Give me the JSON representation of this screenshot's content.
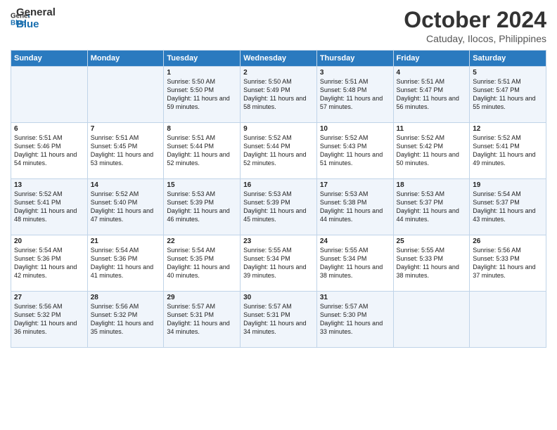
{
  "header": {
    "logo_line1": "General",
    "logo_line2": "Blue",
    "month": "October 2024",
    "location": "Catuday, Ilocos, Philippines"
  },
  "days_of_week": [
    "Sunday",
    "Monday",
    "Tuesday",
    "Wednesday",
    "Thursday",
    "Friday",
    "Saturday"
  ],
  "weeks": [
    [
      {
        "day": "",
        "content": ""
      },
      {
        "day": "",
        "content": ""
      },
      {
        "day": "1",
        "content": "Sunrise: 5:50 AM\nSunset: 5:50 PM\nDaylight: 11 hours and 59 minutes."
      },
      {
        "day": "2",
        "content": "Sunrise: 5:50 AM\nSunset: 5:49 PM\nDaylight: 11 hours and 58 minutes."
      },
      {
        "day": "3",
        "content": "Sunrise: 5:51 AM\nSunset: 5:48 PM\nDaylight: 11 hours and 57 minutes."
      },
      {
        "day": "4",
        "content": "Sunrise: 5:51 AM\nSunset: 5:47 PM\nDaylight: 11 hours and 56 minutes."
      },
      {
        "day": "5",
        "content": "Sunrise: 5:51 AM\nSunset: 5:47 PM\nDaylight: 11 hours and 55 minutes."
      }
    ],
    [
      {
        "day": "6",
        "content": "Sunrise: 5:51 AM\nSunset: 5:46 PM\nDaylight: 11 hours and 54 minutes."
      },
      {
        "day": "7",
        "content": "Sunrise: 5:51 AM\nSunset: 5:45 PM\nDaylight: 11 hours and 53 minutes."
      },
      {
        "day": "8",
        "content": "Sunrise: 5:51 AM\nSunset: 5:44 PM\nDaylight: 11 hours and 52 minutes."
      },
      {
        "day": "9",
        "content": "Sunrise: 5:52 AM\nSunset: 5:44 PM\nDaylight: 11 hours and 52 minutes."
      },
      {
        "day": "10",
        "content": "Sunrise: 5:52 AM\nSunset: 5:43 PM\nDaylight: 11 hours and 51 minutes."
      },
      {
        "day": "11",
        "content": "Sunrise: 5:52 AM\nSunset: 5:42 PM\nDaylight: 11 hours and 50 minutes."
      },
      {
        "day": "12",
        "content": "Sunrise: 5:52 AM\nSunset: 5:41 PM\nDaylight: 11 hours and 49 minutes."
      }
    ],
    [
      {
        "day": "13",
        "content": "Sunrise: 5:52 AM\nSunset: 5:41 PM\nDaylight: 11 hours and 48 minutes."
      },
      {
        "day": "14",
        "content": "Sunrise: 5:52 AM\nSunset: 5:40 PM\nDaylight: 11 hours and 47 minutes."
      },
      {
        "day": "15",
        "content": "Sunrise: 5:53 AM\nSunset: 5:39 PM\nDaylight: 11 hours and 46 minutes."
      },
      {
        "day": "16",
        "content": "Sunrise: 5:53 AM\nSunset: 5:39 PM\nDaylight: 11 hours and 45 minutes."
      },
      {
        "day": "17",
        "content": "Sunrise: 5:53 AM\nSunset: 5:38 PM\nDaylight: 11 hours and 44 minutes."
      },
      {
        "day": "18",
        "content": "Sunrise: 5:53 AM\nSunset: 5:37 PM\nDaylight: 11 hours and 44 minutes."
      },
      {
        "day": "19",
        "content": "Sunrise: 5:54 AM\nSunset: 5:37 PM\nDaylight: 11 hours and 43 minutes."
      }
    ],
    [
      {
        "day": "20",
        "content": "Sunrise: 5:54 AM\nSunset: 5:36 PM\nDaylight: 11 hours and 42 minutes."
      },
      {
        "day": "21",
        "content": "Sunrise: 5:54 AM\nSunset: 5:36 PM\nDaylight: 11 hours and 41 minutes."
      },
      {
        "day": "22",
        "content": "Sunrise: 5:54 AM\nSunset: 5:35 PM\nDaylight: 11 hours and 40 minutes."
      },
      {
        "day": "23",
        "content": "Sunrise: 5:55 AM\nSunset: 5:34 PM\nDaylight: 11 hours and 39 minutes."
      },
      {
        "day": "24",
        "content": "Sunrise: 5:55 AM\nSunset: 5:34 PM\nDaylight: 11 hours and 38 minutes."
      },
      {
        "day": "25",
        "content": "Sunrise: 5:55 AM\nSunset: 5:33 PM\nDaylight: 11 hours and 38 minutes."
      },
      {
        "day": "26",
        "content": "Sunrise: 5:56 AM\nSunset: 5:33 PM\nDaylight: 11 hours and 37 minutes."
      }
    ],
    [
      {
        "day": "27",
        "content": "Sunrise: 5:56 AM\nSunset: 5:32 PM\nDaylight: 11 hours and 36 minutes."
      },
      {
        "day": "28",
        "content": "Sunrise: 5:56 AM\nSunset: 5:32 PM\nDaylight: 11 hours and 35 minutes."
      },
      {
        "day": "29",
        "content": "Sunrise: 5:57 AM\nSunset: 5:31 PM\nDaylight: 11 hours and 34 minutes."
      },
      {
        "day": "30",
        "content": "Sunrise: 5:57 AM\nSunset: 5:31 PM\nDaylight: 11 hours and 34 minutes."
      },
      {
        "day": "31",
        "content": "Sunrise: 5:57 AM\nSunset: 5:30 PM\nDaylight: 11 hours and 33 minutes."
      },
      {
        "day": "",
        "content": ""
      },
      {
        "day": "",
        "content": ""
      }
    ]
  ]
}
